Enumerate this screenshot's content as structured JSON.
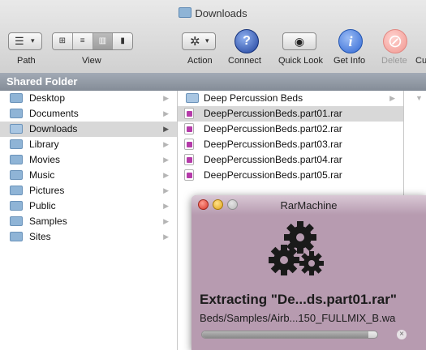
{
  "window": {
    "title": "Downloads"
  },
  "toolbar": {
    "path_label": "Path",
    "view_label": "View",
    "view_modes": [
      "⊞",
      "≡",
      "▥",
      "▮"
    ],
    "selected_view_index": 2,
    "action_label": "Action",
    "connect_label": "Connect",
    "quicklook_label": "Quick Look",
    "getinfo_label": "Get Info",
    "delete_label": "Delete",
    "overflow_label": "Cu",
    "action_glyph": "✲",
    "quicklook_glyph": "◉",
    "getinfo_glyph": "i",
    "delete_glyph": "⊘",
    "connect_glyph": "?"
  },
  "sidebar": {
    "header": "Shared Folder",
    "items": [
      {
        "label": "Desktop",
        "icon": "folder-icon"
      },
      {
        "label": "Documents",
        "icon": "folder-icon"
      },
      {
        "label": "Downloads",
        "icon": "folder-icon",
        "selected": true
      },
      {
        "label": "Library",
        "icon": "folder-icon"
      },
      {
        "label": "Movies",
        "icon": "folder-icon"
      },
      {
        "label": "Music",
        "icon": "folder-icon"
      },
      {
        "label": "Pictures",
        "icon": "folder-icon"
      },
      {
        "label": "Public",
        "icon": "folder-icon"
      },
      {
        "label": "Samples",
        "icon": "folder-icon"
      },
      {
        "label": "Sites",
        "icon": "folder-icon"
      }
    ]
  },
  "files": [
    {
      "label": "Deep Percussion Beds",
      "type": "folder",
      "has_arrow": true
    },
    {
      "label": "DeepPercussionBeds.part01.rar",
      "type": "rar",
      "selected": true
    },
    {
      "label": "DeepPercussionBeds.part02.rar",
      "type": "rar"
    },
    {
      "label": "DeepPercussionBeds.part03.rar",
      "type": "rar"
    },
    {
      "label": "DeepPercussionBeds.part04.rar",
      "type": "rar"
    },
    {
      "label": "DeepPercussionBeds.part05.rar",
      "type": "rar"
    }
  ],
  "rarmachine": {
    "title": "RarMachine",
    "status": "Extracting \"De...ds.part01.rar\"",
    "path": "Beds/Samples/Airb...150_FULLMIX_B.wa",
    "progress": 0.95,
    "cancel_glyph": "×"
  },
  "colors": {
    "rar_bg": "#b79bb0",
    "folder": "#8fb4d6",
    "selection": "#d8d8d8",
    "header": "#8c939e"
  },
  "arrow_glyph": "▶",
  "col3_arrow": "▼"
}
